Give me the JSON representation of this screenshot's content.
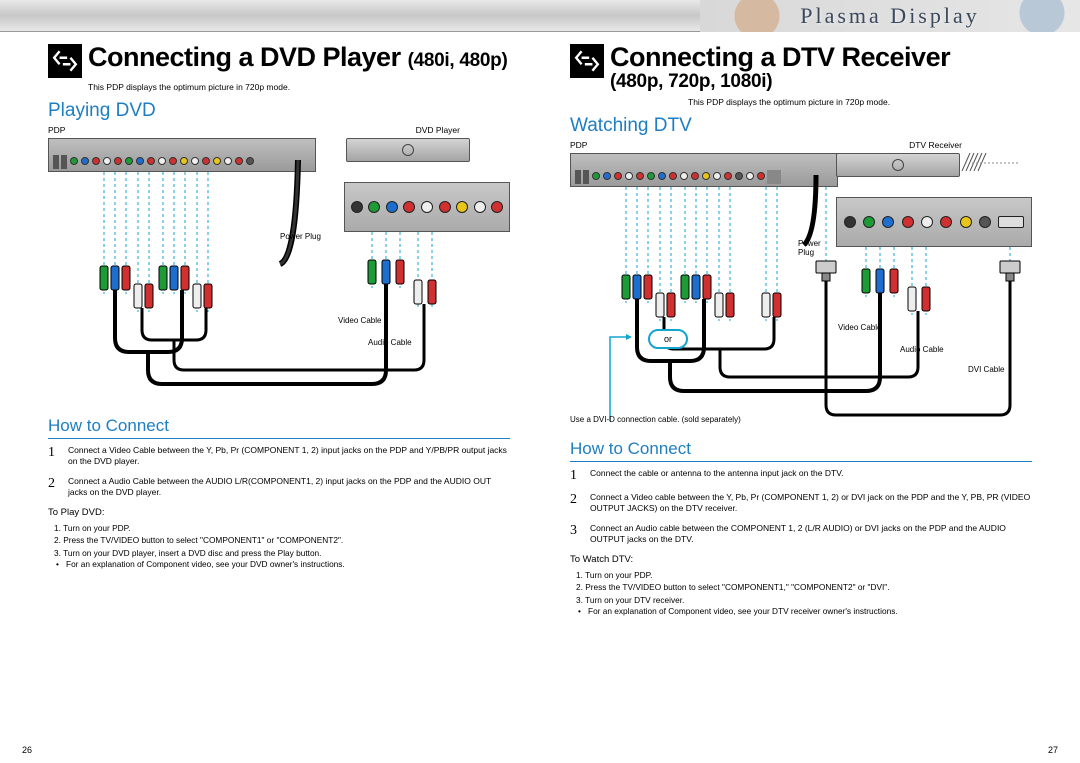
{
  "banner": {
    "plasma_label": "Plasma Display"
  },
  "left": {
    "title_main": "Connecting a DVD Player",
    "title_res": "(480i, 480p)",
    "note": "This PDP displays the optimum picture in 720p mode.",
    "section": "Playing DVD",
    "dev_a": "PDP",
    "dev_b": "DVD Player",
    "lbl_powerplug": "Power Plug",
    "lbl_videocable": "Video Cable",
    "lbl_audiocable": "Audio Cable",
    "howto": "How to Connect",
    "steps": [
      "Connect a Video Cable between the Y, Pb, Pr (COMPONENT 1, 2) input jacks on the PDP and Y/PB/PR output jacks on the DVD player.",
      "Connect a Audio Cable between the AUDIO L/R(COMPONENT1, 2) input jacks on the PDP and the AUDIO OUT jacks on the DVD player."
    ],
    "play_head": "To Play DVD:",
    "play_steps": [
      "1.  Turn on your PDP.",
      "2.  Press the TV/VIDEO button to select \"COMPONENT1\" or \"COMPONENT2\".",
      "3.  Turn on your DVD player, insert a DVD disc and press the Play button."
    ],
    "play_note": "For an explanation of Component video, see your DVD owner's instructions.",
    "page_num": "26"
  },
  "right": {
    "title_main": "Connecting a DTV Receiver",
    "title_res": "(480p, 720p, 1080i)",
    "note": "This PDP displays the optimum picture in 720p mode.",
    "section": "Watching DTV",
    "dev_a": "PDP",
    "dev_b": "DTV Receiver",
    "lbl_powerplug": "Power\nPlug",
    "lbl_videocable": "Video Cable",
    "lbl_audiocable": "Audio Cable",
    "lbl_dvicable": "DVI Cable",
    "lbl_or": "or",
    "footnote": "Use a DVI-D connection cable. (sold separately)",
    "howto": "How to Connect",
    "steps": [
      "Connect the cable or antenna to the antenna input jack on the DTV.",
      "Connect a Video cable between the Y, Pb, Pr (COMPONENT 1, 2) or DVI jack on the PDP and the Y, PB, PR (VIDEO OUTPUT JACKS) on the DTV receiver.",
      "Connect an Audio cable between the COMPONENT 1, 2 (L/R AUDIO) or DVI jacks on the PDP and the AUDIO OUTPUT jacks on the DTV."
    ],
    "play_head": "To Watch DTV:",
    "play_steps": [
      "1.  Turn on your PDP.",
      "2.  Press the TV/VIDEO button to select \"COMPONENT1,\" \"COMPONENT2\" or \"DVI\".",
      "3.  Turn on your DTV receiver."
    ],
    "play_note": "For an explanation of Component video, see your DTV receiver owner's instructions.",
    "page_num": "27"
  }
}
